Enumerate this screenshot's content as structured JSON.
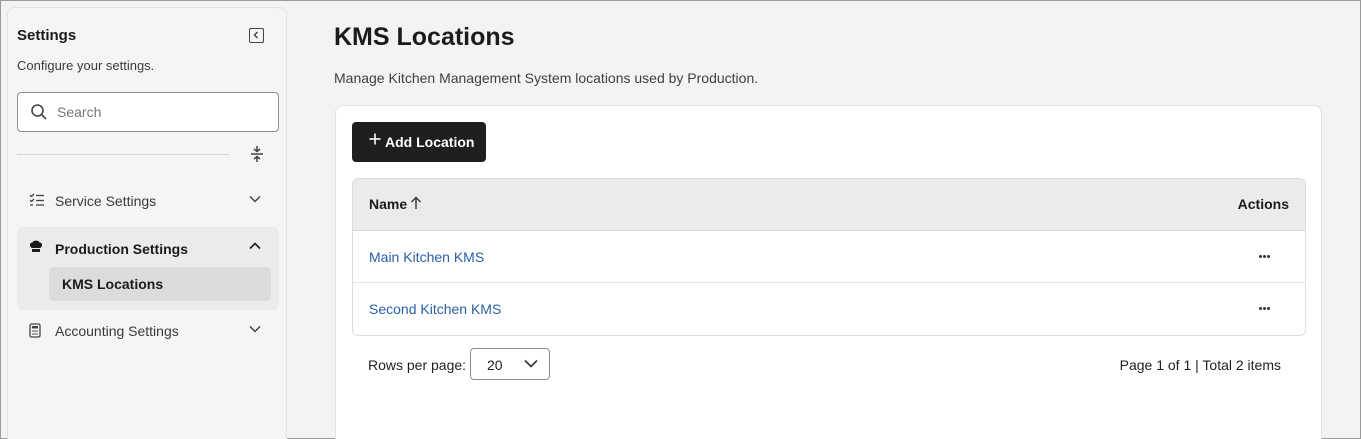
{
  "sidebar": {
    "title": "Settings",
    "subtitle": "Configure your settings.",
    "search_placeholder": "Search",
    "items": [
      {
        "label": "Service Settings",
        "icon": "checklist-icon",
        "expanded": false
      },
      {
        "label": "Production Settings",
        "icon": "chef-hat-icon",
        "expanded": true,
        "children": [
          {
            "label": "KMS Locations",
            "active": true
          }
        ]
      },
      {
        "label": "Accounting Settings",
        "icon": "calculator-icon",
        "expanded": false
      }
    ]
  },
  "main": {
    "title": "KMS Locations",
    "subtitle": "Manage Kitchen Management System locations used by Production.",
    "add_button": "Add Location",
    "table": {
      "columns": [
        "Name",
        "Actions"
      ],
      "sort": {
        "column": "Name",
        "direction": "ascending"
      },
      "rows": [
        {
          "name": "Main Kitchen KMS"
        },
        {
          "name": "Second Kitchen KMS"
        }
      ]
    },
    "pagination": {
      "rows_per_page_label": "Rows per page:",
      "rows_per_page_value": "20",
      "page_info": "Page 1 of 1 | Total 2 items"
    }
  },
  "colors": {
    "link": "#2a5fa8",
    "primary_button": "#1f1f1f",
    "background": "#f3f3f3"
  }
}
